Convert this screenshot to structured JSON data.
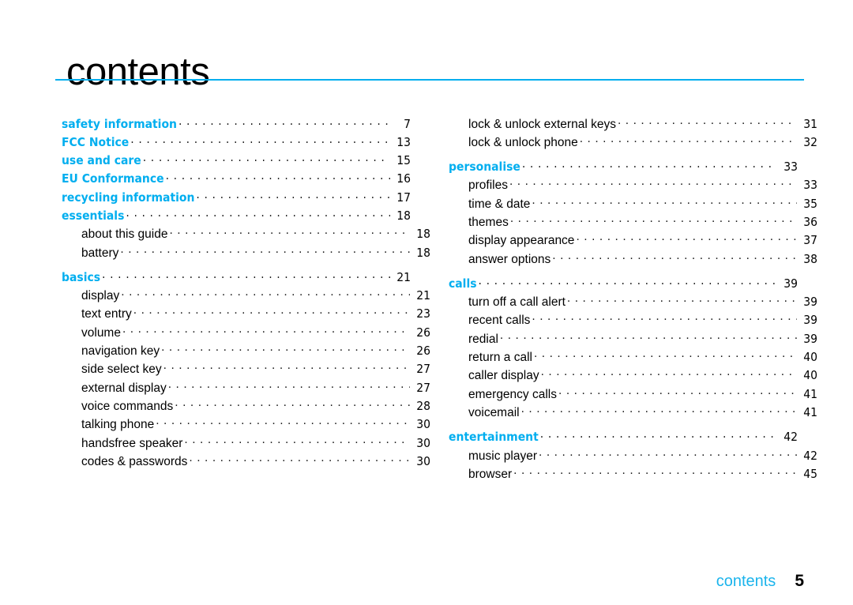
{
  "header": {
    "title": "contents",
    "rule_color": "#00AEEF"
  },
  "colors": {
    "accent": "#00AEEF",
    "text": "#000000",
    "leader": "#1a1a1a"
  },
  "columns": {
    "left": [
      {
        "label": "safety information",
        "page": "7",
        "level": "section",
        "gap": false
      },
      {
        "label": "FCC Notice",
        "page": "13",
        "level": "section",
        "gap": false
      },
      {
        "label": "use and care",
        "page": "15",
        "level": "section",
        "gap": false
      },
      {
        "label": "EU Conformance",
        "page": "16",
        "level": "section",
        "gap": false
      },
      {
        "label": "recycling information",
        "page": "17",
        "level": "section",
        "gap": false
      },
      {
        "label": "essentials",
        "page": "18",
        "level": "section",
        "gap": false
      },
      {
        "label": "about this guide",
        "page": "18",
        "level": "sub",
        "gap": false
      },
      {
        "label": "battery",
        "page": "18",
        "level": "sub",
        "gap": false
      },
      {
        "label": "basics",
        "page": "21",
        "level": "section",
        "gap": true
      },
      {
        "label": "display",
        "page": "21",
        "level": "sub",
        "gap": false
      },
      {
        "label": "text entry",
        "page": "23",
        "level": "sub",
        "gap": false
      },
      {
        "label": "volume",
        "page": "26",
        "level": "sub",
        "gap": false
      },
      {
        "label": "navigation key",
        "page": "26",
        "level": "sub",
        "gap": false
      },
      {
        "label": "side select key",
        "page": "27",
        "level": "sub",
        "gap": false
      },
      {
        "label": "external display",
        "page": "27",
        "level": "sub",
        "gap": false
      },
      {
        "label": "voice commands",
        "page": "28",
        "level": "sub",
        "gap": false
      },
      {
        "label": "talking phone",
        "page": "30",
        "level": "sub",
        "gap": false
      },
      {
        "label": "handsfree speaker",
        "page": "30",
        "level": "sub",
        "gap": false
      },
      {
        "label": "codes & passwords",
        "page": "30",
        "level": "sub",
        "gap": false
      }
    ],
    "right": [
      {
        "label": "lock & unlock external keys",
        "page": "31",
        "level": "sub",
        "gap": false
      },
      {
        "label": "lock & unlock phone",
        "page": "32",
        "level": "sub",
        "gap": false
      },
      {
        "label": "personalise",
        "page": "33",
        "level": "section",
        "gap": true
      },
      {
        "label": "profiles",
        "page": "33",
        "level": "sub",
        "gap": false
      },
      {
        "label": "time & date",
        "page": "35",
        "level": "sub",
        "gap": false
      },
      {
        "label": "themes",
        "page": "36",
        "level": "sub",
        "gap": false
      },
      {
        "label": "display appearance",
        "page": "37",
        "level": "sub",
        "gap": false
      },
      {
        "label": "answer options",
        "page": "38",
        "level": "sub",
        "gap": false
      },
      {
        "label": "calls",
        "page": "39",
        "level": "section",
        "gap": true
      },
      {
        "label": "turn off a call alert",
        "page": "39",
        "level": "sub",
        "gap": false
      },
      {
        "label": "recent calls",
        "page": "39",
        "level": "sub",
        "gap": false
      },
      {
        "label": "redial",
        "page": "39",
        "level": "sub",
        "gap": false
      },
      {
        "label": "return a call",
        "page": "40",
        "level": "sub",
        "gap": false
      },
      {
        "label": "caller display",
        "page": "40",
        "level": "sub",
        "gap": false
      },
      {
        "label": "emergency calls",
        "page": "41",
        "level": "sub",
        "gap": false
      },
      {
        "label": "voicemail",
        "page": "41",
        "level": "sub",
        "gap": false
      },
      {
        "label": "entertainment",
        "page": "42",
        "level": "section",
        "gap": true
      },
      {
        "label": "music player",
        "page": "42",
        "level": "sub",
        "gap": false
      },
      {
        "label": "browser",
        "page": "45",
        "level": "sub",
        "gap": false
      }
    ]
  },
  "footer": {
    "label": "contents",
    "page_number": "5"
  }
}
